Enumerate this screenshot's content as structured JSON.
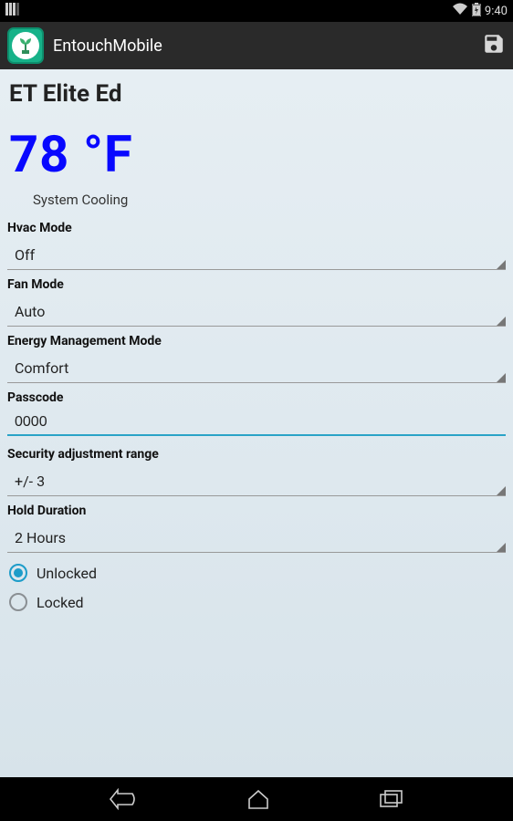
{
  "status_bar": {
    "time": "9:40"
  },
  "action_bar": {
    "app_name": "EntouchMobile"
  },
  "page": {
    "title": "ET Elite Ed",
    "temperature": "78 °F",
    "system_status": "System Cooling"
  },
  "fields": {
    "hvac_mode": {
      "label": "Hvac Mode",
      "value": "Off"
    },
    "fan_mode": {
      "label": "Fan Mode",
      "value": "Auto"
    },
    "energy_mode": {
      "label": "Energy Management Mode",
      "value": "Comfort"
    },
    "passcode": {
      "label": "Passcode",
      "value": "0000"
    },
    "security_range": {
      "label": "Security adjustment range",
      "value": "+/- 3"
    },
    "hold_duration": {
      "label": "Hold Duration",
      "value": "2 Hours"
    }
  },
  "lock_radio": {
    "unlocked_label": "Unlocked",
    "locked_label": "Locked",
    "selected": "unlocked"
  }
}
